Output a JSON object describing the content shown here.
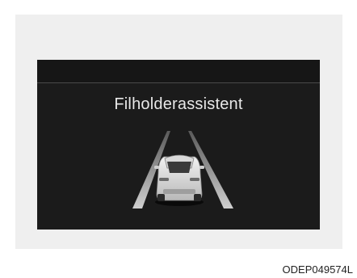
{
  "display": {
    "title": "Filholderassistent",
    "icon": "lane-following-assist-car-icon"
  },
  "caption": {
    "code": "ODEP049574L"
  }
}
